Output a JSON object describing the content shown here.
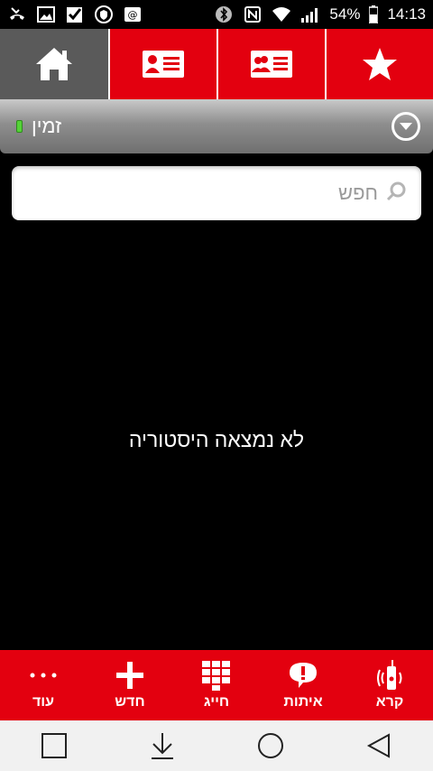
{
  "status": {
    "battery_percent": "54%",
    "time": "14:13"
  },
  "account": {
    "name": "זמין"
  },
  "search": {
    "placeholder": "חפש"
  },
  "main": {
    "empty_message": "לא נמצאה היסטוריה"
  },
  "actions": [
    {
      "label": "עוד",
      "icon": "more-icon"
    },
    {
      "label": "חדש",
      "icon": "plus-icon"
    },
    {
      "label": "חייג",
      "icon": "dialpad-icon"
    },
    {
      "label": "איתות",
      "icon": "alert-icon"
    },
    {
      "label": "קרא",
      "icon": "walkie-talkie-icon"
    }
  ],
  "colors": {
    "accent": "#e3000f",
    "tab_selected": "#5a5a5a"
  }
}
